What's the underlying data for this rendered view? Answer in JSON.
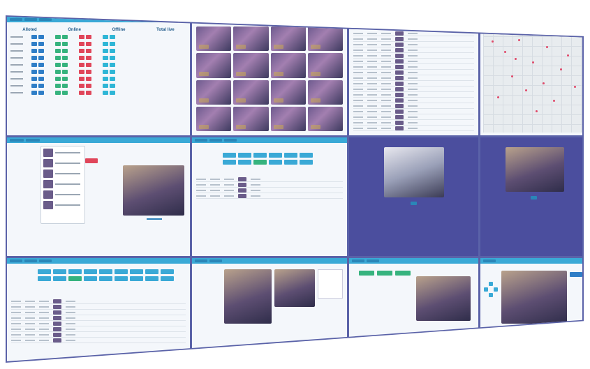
{
  "dashboard": {
    "stats": {
      "headers": [
        "Alloted",
        "Online",
        "Offline",
        "Total live"
      ]
    }
  },
  "colors": {
    "frame": "#5a62a8",
    "panel_bg": "#f4f7fb",
    "accent": "#3aa9d6",
    "status_green": "#36b37e",
    "status_red": "#e0465a"
  }
}
